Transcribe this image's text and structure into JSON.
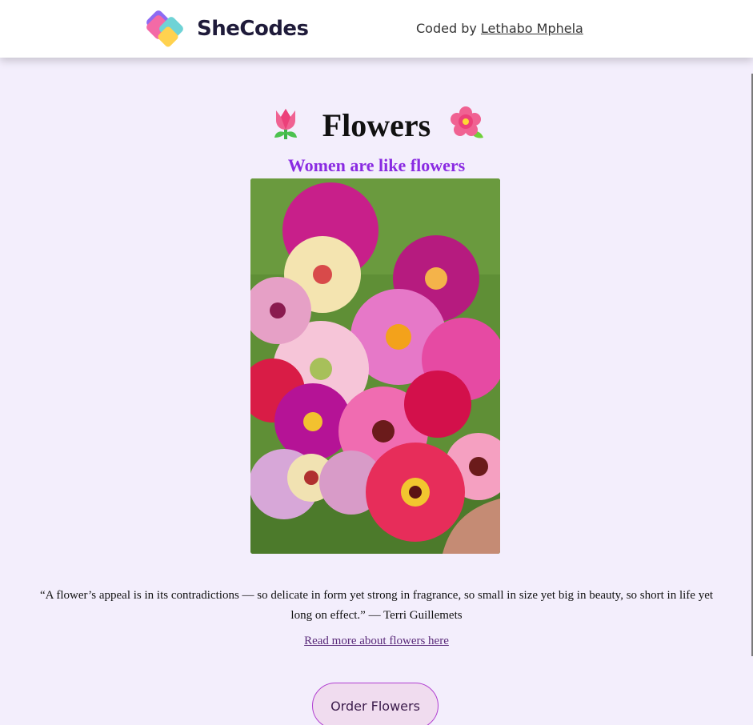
{
  "header": {
    "logo_text": "SheCodes",
    "logo_icon": "shecodes-logo-icon",
    "coded_by_prefix": "Coded by",
    "author_name": "Lethabo Mphela"
  },
  "main": {
    "title": "Flowers",
    "title_emoji_left": "tulip-icon",
    "title_emoji_right": "hibiscus-icon",
    "subtitle": "Women are like flowers",
    "image": "flower-bouquet-photo",
    "quote_line1": "“A flower’s appeal is in its contradictions — so delicate in form yet strong in fragrance, so small in size yet big in beauty, so short in life yet",
    "quote_line2": "long on effect.” — Terri Guillemets",
    "read_more": "Read more about flowers here",
    "order_button": "Order Flowers"
  },
  "colors": {
    "page_background": "#f3eefc",
    "subtitle_purple": "#8a2be2",
    "button_border": "#b13fd1",
    "button_fill": "#f0dcef",
    "link_color": "#5a2a7a"
  }
}
